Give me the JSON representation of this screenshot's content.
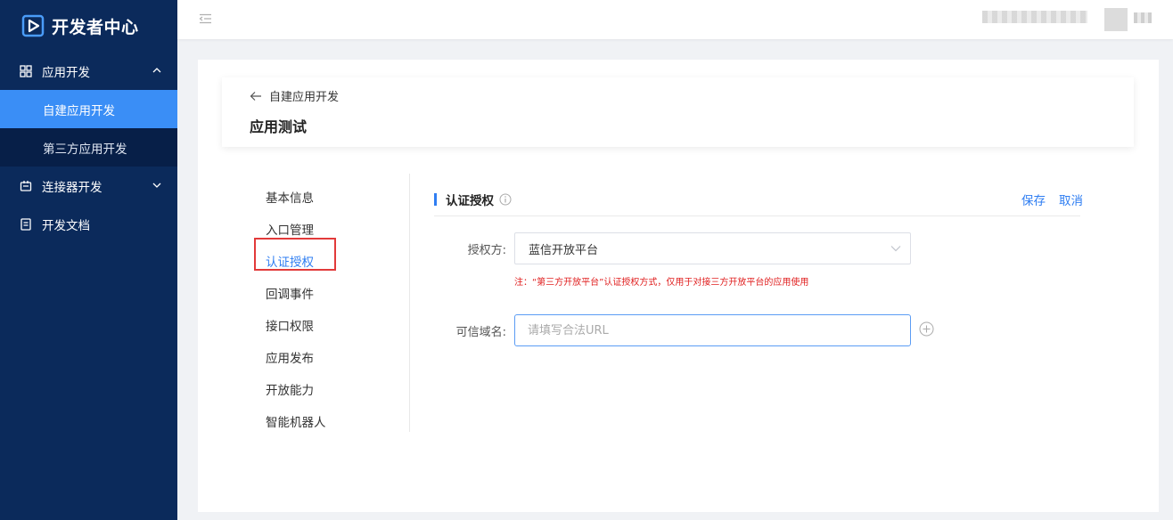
{
  "app": {
    "title": "开发者中心"
  },
  "sidebar": {
    "groups": [
      {
        "label": "应用开发",
        "icon": "grid-icon",
        "expanded": true,
        "items": [
          {
            "label": "自建应用开发",
            "active": true
          },
          {
            "label": "第三方应用开发",
            "active": false
          }
        ]
      },
      {
        "label": "连接器开发",
        "icon": "connector-icon",
        "expanded": false
      },
      {
        "label": "开发文档",
        "icon": "document-icon"
      }
    ]
  },
  "header": {
    "back_label": "自建应用开发",
    "title": "应用测试"
  },
  "left_menu": {
    "items": [
      "基本信息",
      "入口管理",
      "认证授权",
      "回调事件",
      "接口权限",
      "应用发布",
      "开放能力",
      "智能机器人"
    ],
    "active_index": 2
  },
  "section": {
    "title": "认证授权",
    "save_label": "保存",
    "cancel_label": "取消"
  },
  "form": {
    "auth_label": "授权方:",
    "auth_value": "蓝信开放平台",
    "note": "注：“第三方开放平台”认证授权方式，仅用于对接三方开放平台的应用使用",
    "domain_label": "可信域名:",
    "domain_placeholder": "请填写合法URL",
    "domain_value": ""
  },
  "colors": {
    "sidebar_bg": "#0b2a5b",
    "accent": "#2f7ef2",
    "active_nav": "#3a8ef6",
    "warning": "#e02020"
  }
}
